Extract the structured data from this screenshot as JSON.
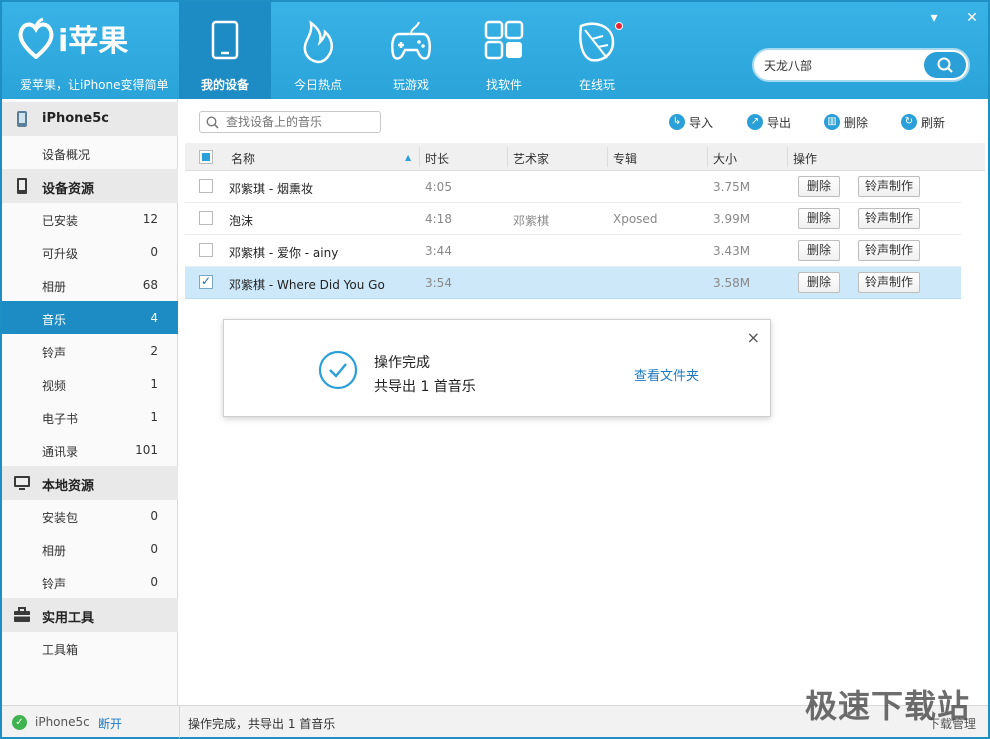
{
  "header": {
    "brand": "i苹果",
    "slogan": "爱苹果，让iPhone变得简单",
    "nav": [
      {
        "label": "我的设备",
        "icon": "tablet-icon",
        "active": true
      },
      {
        "label": "今日热点",
        "icon": "flame-icon"
      },
      {
        "label": "玩游戏",
        "icon": "gamepad-icon"
      },
      {
        "label": "找软件",
        "icon": "apps-grid-icon"
      },
      {
        "label": "在线玩",
        "icon": "leaf-icon",
        "badge": "red-dot"
      }
    ],
    "search_value": "天龙八部",
    "window_menu": "▾",
    "window_close": "✕"
  },
  "sidebar": {
    "device": {
      "label": "iPhone5c",
      "icon": "phone-icon"
    },
    "device_items": [
      {
        "label": "设备概况"
      }
    ],
    "resources": {
      "label": "设备资源",
      "icon": "device-resource-icon"
    },
    "resource_items": [
      {
        "label": "已安装",
        "count": "12"
      },
      {
        "label": "可升级",
        "count": "0"
      },
      {
        "label": "相册",
        "count": "68"
      },
      {
        "label": "音乐",
        "count": "4",
        "active": true
      },
      {
        "label": "铃声",
        "count": "2"
      },
      {
        "label": "视频",
        "count": "1"
      },
      {
        "label": "电子书",
        "count": "1"
      },
      {
        "label": "通讯录",
        "count": "101"
      }
    ],
    "local": {
      "label": "本地资源",
      "icon": "monitor-icon"
    },
    "local_items": [
      {
        "label": "安装包",
        "count": "0"
      },
      {
        "label": "相册",
        "count": "0"
      },
      {
        "label": "铃声",
        "count": "0"
      }
    ],
    "tools": {
      "label": "实用工具",
      "icon": "toolbox-icon"
    },
    "tool_items": [
      {
        "label": "工具箱"
      }
    ]
  },
  "toolbar": {
    "search_placeholder": "查找设备上的音乐",
    "import": "导入",
    "export": "导出",
    "delete": "删除",
    "refresh": "刷新"
  },
  "table": {
    "headers": {
      "name": "名称",
      "duration": "时长",
      "artist": "艺术家",
      "album": "专辑",
      "size": "大小",
      "action": "操作"
    },
    "rows": [
      {
        "name": "邓紫琪 - 烟熏妆",
        "duration": "4:05",
        "artist": "",
        "album": "",
        "size": "3.75M",
        "checked": false
      },
      {
        "name": "泡沫",
        "duration": "4:18",
        "artist": "邓紫棋",
        "album": "Xposed",
        "size": "3.99M",
        "checked": false
      },
      {
        "name": "邓紫棋 - 爱你 - ainy",
        "duration": "3:44",
        "artist": "",
        "album": "",
        "size": "3.43M",
        "checked": false
      },
      {
        "name": "邓紫棋 - Where Did You Go",
        "duration": "3:54",
        "artist": "",
        "album": "",
        "size": "3.58M",
        "checked": true
      }
    ],
    "delete_btn": "删除",
    "ringtone_btn": "铃声制作"
  },
  "toast": {
    "title": "操作完成",
    "message": "共导出 1 首音乐",
    "link": "查看文件夹",
    "close": "×"
  },
  "status": {
    "device": "iPhone5c",
    "disconnect": "断开",
    "message": "操作完成，共导出 1 首音乐",
    "tail": "下载管理"
  },
  "watermark": "极速下载站",
  "colors": {
    "accent": "#2aa3d9",
    "active": "#1d8cc4",
    "link": "#1e79c2",
    "selected_row": "#cde8f8"
  }
}
